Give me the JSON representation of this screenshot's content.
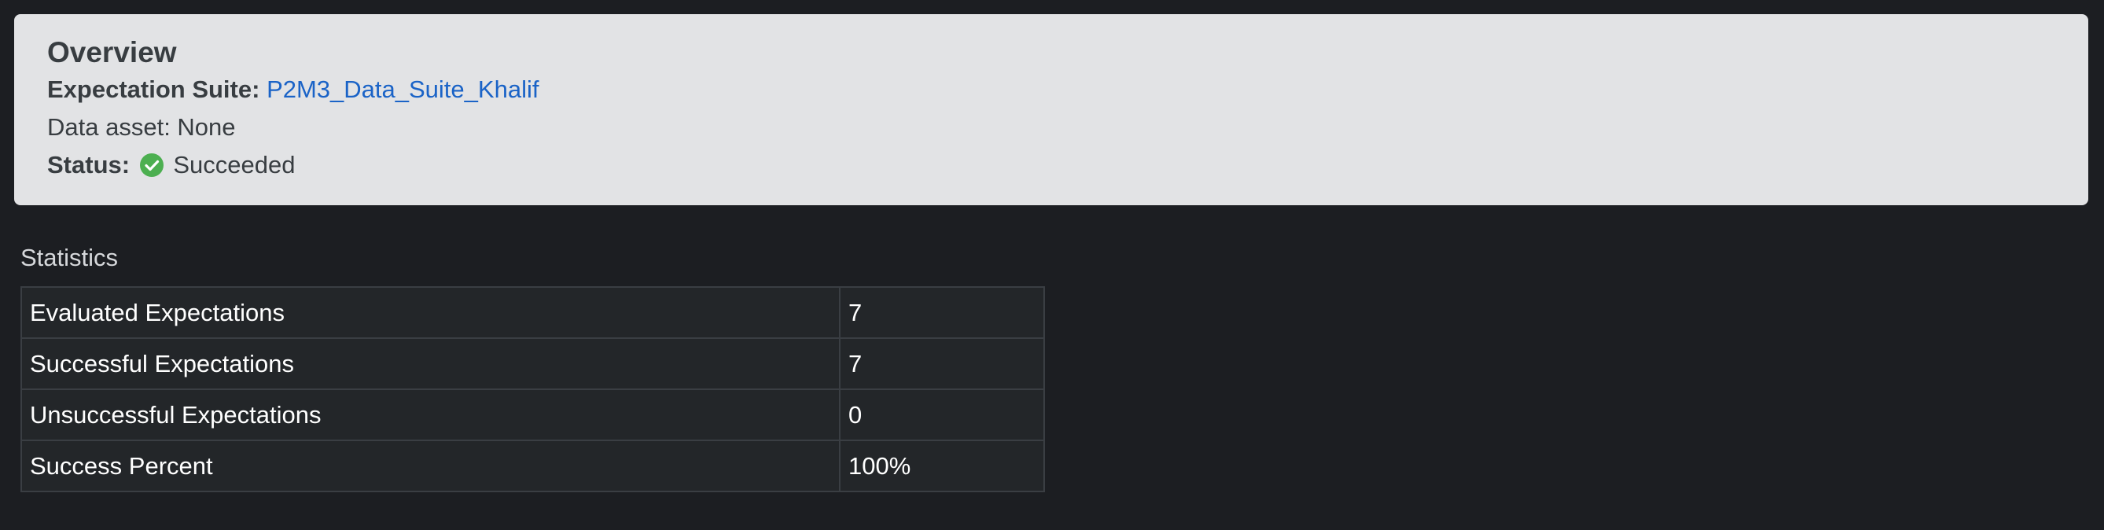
{
  "overview": {
    "title": "Overview",
    "suite_label": "Expectation Suite:",
    "suite_name": "P2M3_Data_Suite_Khalif",
    "data_asset_text": "Data asset: None",
    "status_label": "Status:",
    "status_icon": "check-circle-icon",
    "status_value": "Succeeded"
  },
  "statistics": {
    "title": "Statistics",
    "rows": [
      {
        "label": "Evaluated Expectations",
        "value": "7"
      },
      {
        "label": "Successful Expectations",
        "value": "7"
      },
      {
        "label": "Unsuccessful Expectations",
        "value": "0"
      },
      {
        "label": "Success Percent",
        "value": "100%"
      }
    ]
  },
  "colors": {
    "background": "#1c1e22",
    "card": "#e2e3e5",
    "link": "#1a63c7",
    "success": "#4caf50"
  }
}
